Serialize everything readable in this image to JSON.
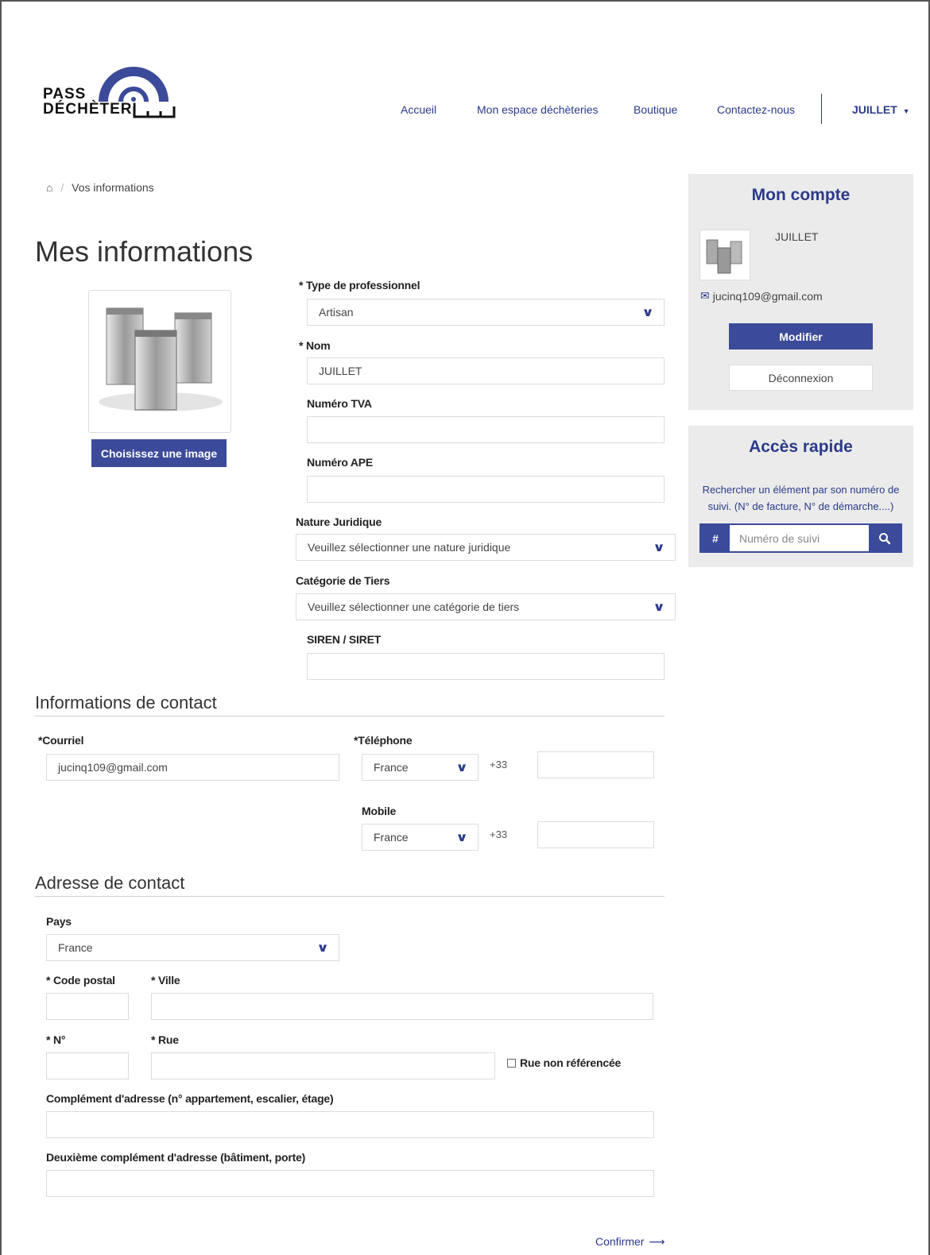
{
  "header": {
    "logo_line1": "PASS",
    "logo_line2": "DÉCHÈTERI",
    "nav": [
      "Accueil",
      "Mon espace déchèteries",
      "Boutique",
      "Contactez-nous"
    ],
    "user": "JUILLET"
  },
  "breadcrumb": {
    "current": "Vos informations"
  },
  "page_title": "Mes informations",
  "image_button": "Choisissez une image",
  "form": {
    "type_label": "Type de professionnel",
    "type_value": "Artisan",
    "nom_label": "Nom",
    "nom_value": "JUILLET",
    "tva_label": "Numéro TVA",
    "ape_label": "Numéro APE",
    "nature_label": "Nature Juridique",
    "nature_placeholder": "Veuillez sélectionner une nature juridique",
    "categorie_label": "Catégorie de Tiers",
    "categorie_placeholder": "Veuillez sélectionner une catégorie de tiers",
    "siren_label": "SIREN / SIRET"
  },
  "contact": {
    "heading": "Informations de contact",
    "courriel_label": "Courriel",
    "courriel_value": "jucinq109@gmail.com",
    "telephone_label": "Téléphone",
    "telephone_country": "France",
    "telephone_prefix": "+33",
    "mobile_label": "Mobile",
    "mobile_country": "France",
    "mobile_prefix": "+33"
  },
  "address": {
    "heading": "Adresse de contact",
    "pays_label": "Pays",
    "pays_value": "France",
    "cp_label": "Code postal",
    "ville_label": "Ville",
    "num_label": "N°",
    "rue_label": "Rue",
    "rue_non_ref": "Rue non référencée",
    "complement_label": "Complément d'adresse (n° appartement, escalier, étage)",
    "complement2_label": "Deuxième complément d'adresse (bâtiment, porte)",
    "confirm": "Confirmer"
  },
  "account": {
    "title": "Mon compte",
    "name": "JUILLET",
    "email": "jucinq109@gmail.com",
    "modify": "Modifier",
    "logout": "Déconnexion"
  },
  "quick": {
    "title": "Accès rapide",
    "desc": "Rechercher un élément par son numéro de suivi. (N° de facture, N° de démarche....)",
    "hash": "#",
    "placeholder": "Numéro de suivi"
  },
  "required_mark": "*",
  "colors": {
    "brand": "#2b3a8a",
    "button": "#3c4a9a",
    "panel": "#ebebeb"
  }
}
